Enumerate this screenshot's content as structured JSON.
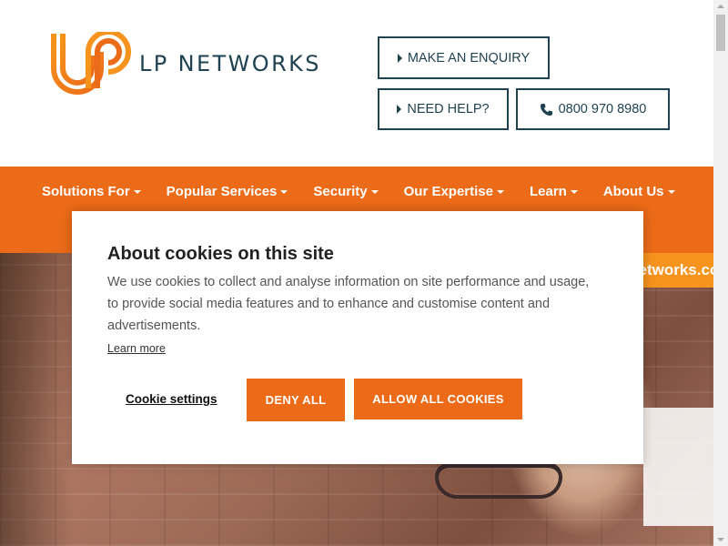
{
  "header": {
    "logo_text": "LP NETWORKS",
    "enquiry_label": "MAKE AN ENQUIRY",
    "help_label": "NEED HELP?",
    "phone_label": "0800 970 8980"
  },
  "nav": {
    "items": [
      {
        "label": "Solutions For"
      },
      {
        "label": "Popular Services"
      },
      {
        "label": "Security"
      },
      {
        "label": "Our Expertise"
      },
      {
        "label": "Learn"
      },
      {
        "label": "About Us"
      }
    ]
  },
  "hero": {
    "site_tab": "lpnetworks.com"
  },
  "cookie": {
    "title": "About cookies on this site",
    "body": "We use cookies to collect and analyse information on site performance and usage, to provide social media features and to enhance and customise content and advertisements.",
    "learn_more": "Learn more",
    "settings_label": "Cookie settings",
    "deny_label": "DENY ALL",
    "allow_label": "ALLOW ALL COOKIES"
  },
  "colors": {
    "brand_orange": "#ec6b18",
    "brand_dark": "#1e4251",
    "accent_orange": "#f7941d"
  },
  "icons": {
    "logo": "lp-logo-icon",
    "triangle": "triangle-right-icon",
    "phone": "phone-icon",
    "caret": "caret-down-icon"
  }
}
